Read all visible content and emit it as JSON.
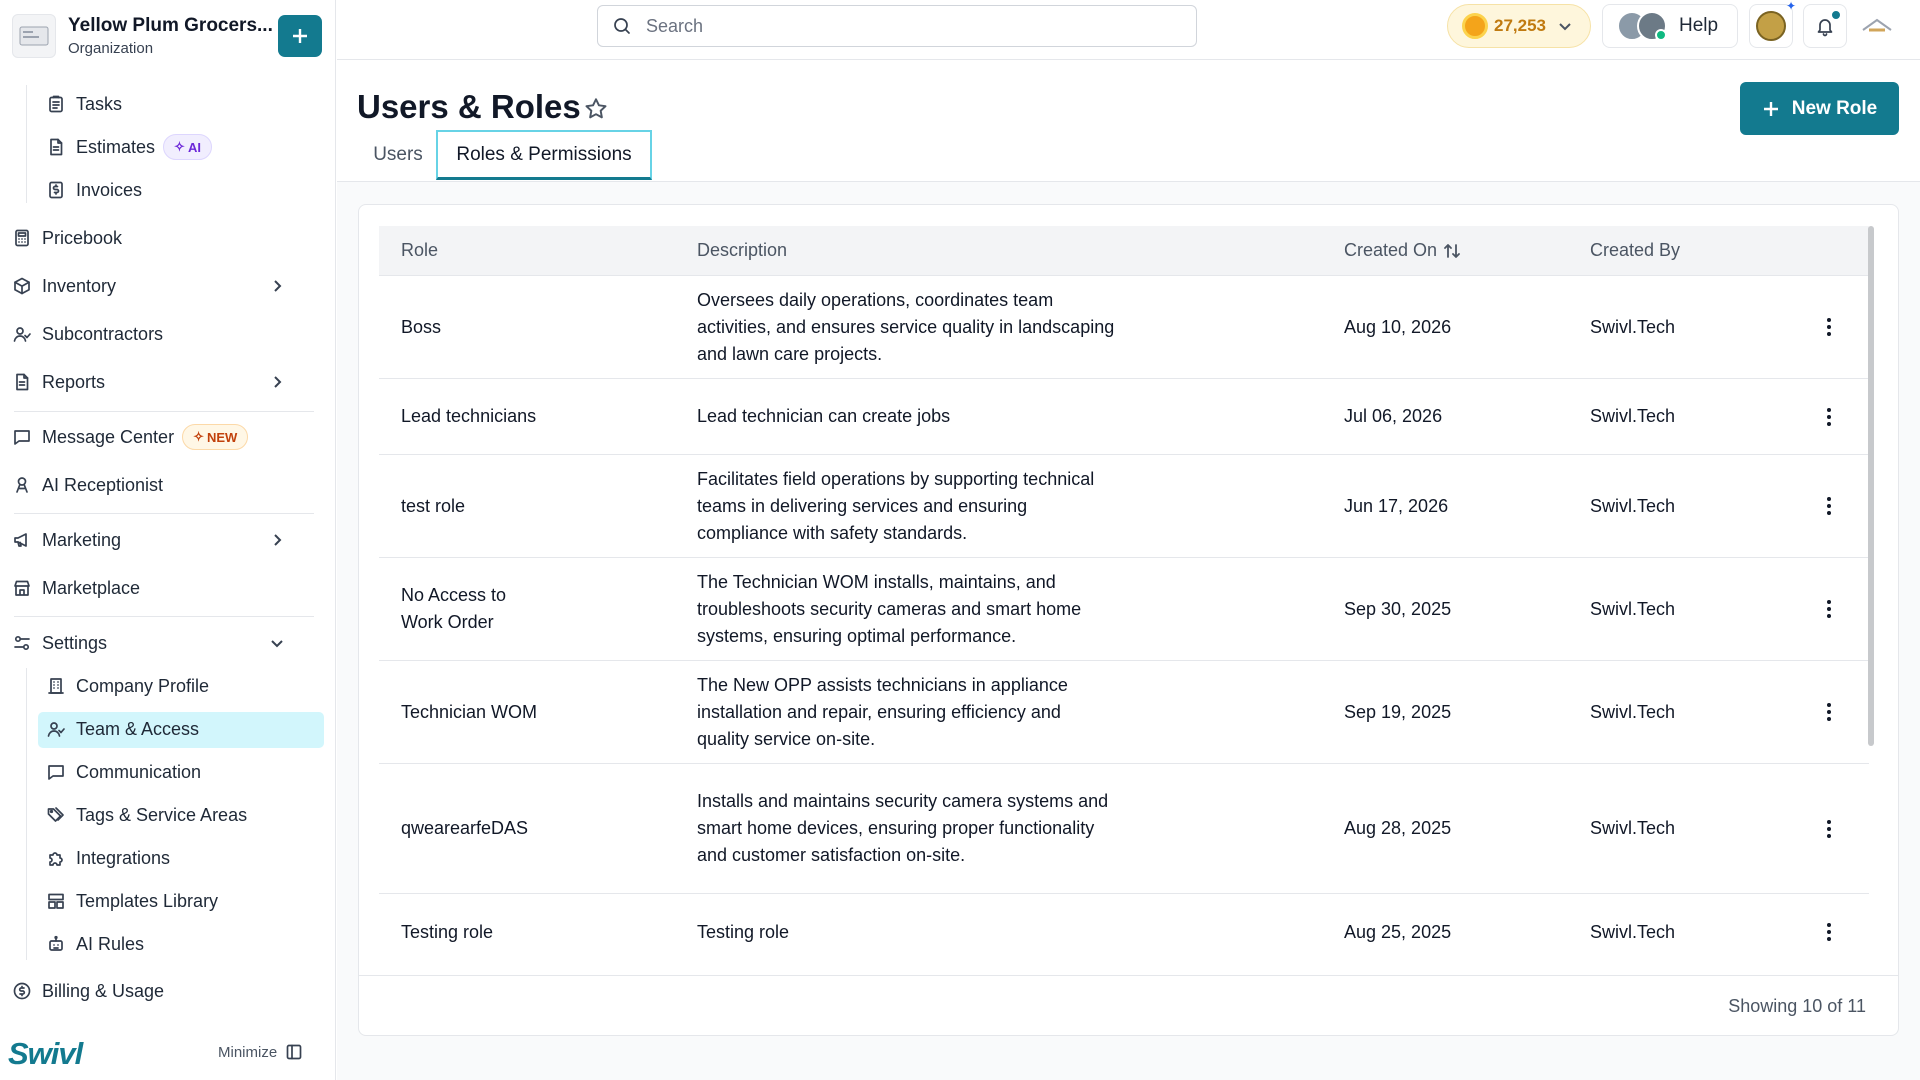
{
  "org": {
    "name": "Yellow Plum Grocers...",
    "subtitle": "Organization"
  },
  "sidebar": {
    "items": [
      {
        "label": "Tasks",
        "icon": "clipboard-icon"
      },
      {
        "label": "Estimates",
        "icon": "document-icon",
        "badge": "AI"
      },
      {
        "label": "Invoices",
        "icon": "invoice-icon"
      },
      {
        "label": "Pricebook",
        "icon": "calculator-icon"
      },
      {
        "label": "Inventory",
        "icon": "box-icon"
      },
      {
        "label": "Subcontractors",
        "icon": "users-icon"
      },
      {
        "label": "Reports",
        "icon": "report-icon"
      },
      {
        "label": "Message Center",
        "icon": "message-icon",
        "badge": "NEW"
      },
      {
        "label": "AI Receptionist",
        "icon": "receptionist-icon"
      },
      {
        "label": "Marketing",
        "icon": "megaphone-icon"
      },
      {
        "label": "Marketplace",
        "icon": "store-icon"
      },
      {
        "label": "Settings",
        "icon": "settings-icon"
      },
      {
        "label": "Company Profile",
        "icon": "building-icon"
      },
      {
        "label": "Team & Access",
        "icon": "team-icon"
      },
      {
        "label": "Communication",
        "icon": "chat-icon"
      },
      {
        "label": "Tags & Service Areas",
        "icon": "tags-icon"
      },
      {
        "label": "Integrations",
        "icon": "puzzle-icon"
      },
      {
        "label": "Templates Library",
        "icon": "templates-icon"
      },
      {
        "label": "AI Rules",
        "icon": "robot-icon"
      },
      {
        "label": "Billing & Usage",
        "icon": "dollar-icon"
      }
    ],
    "active": "Team & Access",
    "logo": "Swivl",
    "minimize_label": "Minimize"
  },
  "topbar": {
    "search_placeholder": "Search",
    "points": "27,253",
    "help_label": "Help"
  },
  "page": {
    "title": "Users & Roles",
    "new_role_label": "New Role",
    "tabs": [
      {
        "label": "Users"
      },
      {
        "label": "Roles & Permissions"
      }
    ],
    "active_tab": "Roles & Permissions"
  },
  "table": {
    "headers": [
      "Role",
      "Description",
      "Created On",
      "Created By"
    ],
    "rows": [
      {
        "role": "Boss",
        "description": "Oversees daily operations, coordinates team activities, and ensures service quality in landscaping and lawn care projects.",
        "created_on": "Aug 10, 2026",
        "created_by": "Swivl.Tech"
      },
      {
        "role": "Lead technicians",
        "description": "Lead technician can create jobs",
        "created_on": "Jul 06, 2026",
        "created_by": "Swivl.Tech"
      },
      {
        "role": "test role",
        "description": "Facilitates field operations by supporting technical teams in delivering services and ensuring compliance with safety standards.",
        "created_on": "Jun 17, 2026",
        "created_by": "Swivl.Tech"
      },
      {
        "role": "No Access to Work Order",
        "description": "The Technician WOM installs, maintains, and troubleshoots security cameras and smart home systems, ensuring optimal performance.",
        "created_on": "Sep 30, 2025",
        "created_by": "Swivl.Tech"
      },
      {
        "role": "Technician WOM",
        "description": "The New OPP assists technicians in appliance installation and repair, ensuring efficiency and quality service on-site.",
        "created_on": "Sep 19, 2025",
        "created_by": "Swivl.Tech"
      },
      {
        "role": "qwearearfeDAS",
        "description": "Installs and maintains security camera systems and smart home devices, ensuring proper functionality and customer satisfaction on-site.",
        "created_on": "Aug 28, 2025",
        "created_by": "Swivl.Tech"
      },
      {
        "role": "Testing role",
        "description": "Testing role",
        "created_on": "Aug 25, 2025",
        "created_by": "Swivl.Tech"
      }
    ],
    "showing": "Showing 10 of 11"
  },
  "colors": {
    "accent": "#137a8f",
    "active_nav": "#d2f6fc",
    "points_text": "#c07a10"
  }
}
